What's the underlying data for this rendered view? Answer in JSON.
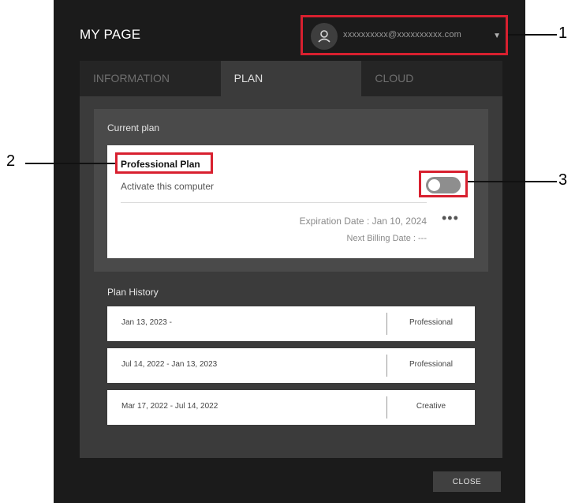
{
  "window": {
    "title": "MY PAGE",
    "account": {
      "email": "xxxxxxxxxx@xxxxxxxxxx.com",
      "avatar_icon": "user-icon",
      "dropdown_icon": "caret-down-icon"
    }
  },
  "tabs": [
    {
      "label": "INFORMATION",
      "active": false
    },
    {
      "label": "PLAN",
      "active": true
    },
    {
      "label": "CLOUD",
      "active": false
    }
  ],
  "current_plan": {
    "section_label": "Current plan",
    "plan_name": "Professional Plan",
    "activate_label": "Activate this computer",
    "activated": false,
    "expiration": "Expiration Date : Jan 10, 2024",
    "next_billing": "Next Billing Date : ---",
    "more_icon": "more-dots-icon",
    "more_glyph": "•••"
  },
  "plan_history": {
    "section_label": "Plan History",
    "rows": [
      {
        "dates": "Jan 13, 2023 -",
        "plan": "Professional"
      },
      {
        "dates": "Jul 14, 2022 - Jan 13, 2023",
        "plan": "Professional"
      },
      {
        "dates": "Mar 17, 2022 - Jul 14, 2022",
        "plan": "Creative"
      }
    ]
  },
  "close_label": "CLOSE",
  "callouts": [
    "1",
    "2",
    "3"
  ],
  "colors": {
    "callout": "#d8202f",
    "background": "#1b1b1b",
    "panel": "#3b3b3b"
  }
}
